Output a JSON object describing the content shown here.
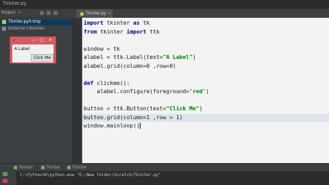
{
  "window": {
    "title": "Tkinter.py"
  },
  "toolbar": {
    "project_label": "Project",
    "project_caret": "▾"
  },
  "editor_tab": {
    "label": "Tkinter.py",
    "close": "×"
  },
  "project_tree": [
    {
      "name": "Tkinter.py0.tmp",
      "selected": true
    },
    {
      "name": "External Libraries",
      "selected": false
    }
  ],
  "code": [
    [
      {
        "t": "import",
        "c": "kw"
      },
      {
        "t": " tkinter "
      },
      {
        "t": "as",
        "c": "kw"
      },
      {
        "t": " tk"
      }
    ],
    [
      {
        "t": "from",
        "c": "kw"
      },
      {
        "t": " tkinter "
      },
      {
        "t": "import",
        "c": "kw"
      },
      {
        "t": " ttk"
      }
    ],
    [],
    [
      {
        "t": "window = tk"
      }
    ],
    [
      {
        "t": "alabel = ttk.Label(text="
      },
      {
        "t": "\"A Label\"",
        "c": "str"
      },
      {
        "t": ")"
      }
    ],
    [
      {
        "t": "alabel.grid(column=0 ,row=0)"
      }
    ],
    [],
    [
      {
        "t": "def",
        "c": "kw"
      },
      {
        "t": " clickme():"
      }
    ],
    [
      {
        "t": "    alabel.configure(foreground="
      },
      {
        "t": "'red'",
        "c": "str"
      },
      {
        "t": ")"
      }
    ],
    [],
    [
      {
        "t": "button = ttk.Button(text="
      },
      {
        "t": "\"Click Me\"",
        "c": "str"
      },
      {
        "t": ")"
      }
    ],
    [
      {
        "t": "button.grid(column=1 ,row = 1)"
      }
    ],
    [
      {
        "t": "window.mainloop()"
      }
    ]
  ],
  "highlight_line": 11,
  "tk_window": {
    "feather": "✓",
    "min": "—",
    "max": "□",
    "close": "✕",
    "label": "A Label",
    "button": "Click Me"
  },
  "run_tabs": [
    "Tkinter",
    "Tkinter",
    "Tkinter"
  ],
  "console": {
    "line": "C:\\Python34\\python.exe \"E:/New folder/Scratch/Tkinter.py\""
  },
  "colors": {
    "editor_bg": "#f3f3f3",
    "keyword": "#000080",
    "string": "#008000",
    "selection": "#0d3a5a",
    "tk_window_frame": "#d85a61"
  }
}
